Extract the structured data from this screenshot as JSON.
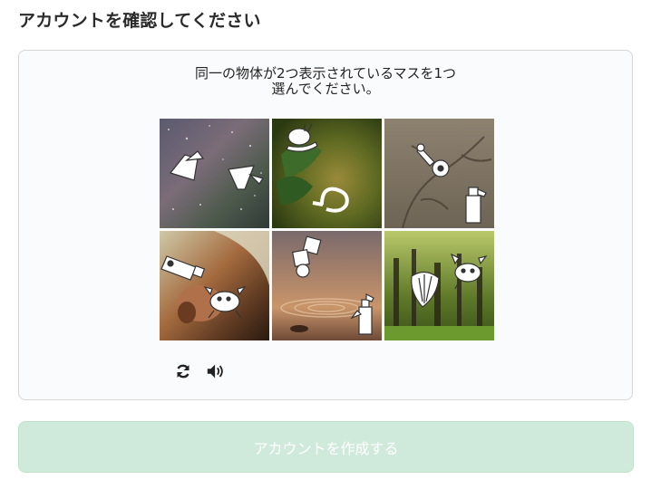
{
  "page": {
    "title": "アカウントを確認してください"
  },
  "captcha": {
    "instruction_line1": "同一の物体が2つ表示されているマスを1つ",
    "instruction_line2": "選んでください。",
    "tiles": [
      {
        "background": "starry-night-sky",
        "objects": [
          "lamp-shade",
          "lamp-shade"
        ]
      },
      {
        "background": "leaves-green",
        "objects": [
          "snail",
          "bead-necklace"
        ]
      },
      {
        "background": "bare-branches",
        "objects": [
          "key-tag",
          "spray-bottle"
        ]
      },
      {
        "background": "flower-macro",
        "objects": [
          "battery",
          "crab"
        ]
      },
      {
        "background": "water-drops",
        "objects": [
          "dice-stack",
          "spray-bottle"
        ]
      },
      {
        "background": "forest-trees",
        "objects": [
          "shell",
          "crab"
        ]
      }
    ],
    "controls": {
      "refresh": "refresh-icon",
      "audio": "speaker-icon"
    }
  },
  "actions": {
    "submit_label": "アカウントを作成する"
  },
  "colors": {
    "submit_bg": "#cfeadb",
    "panel_border": "#d6d6d6"
  }
}
